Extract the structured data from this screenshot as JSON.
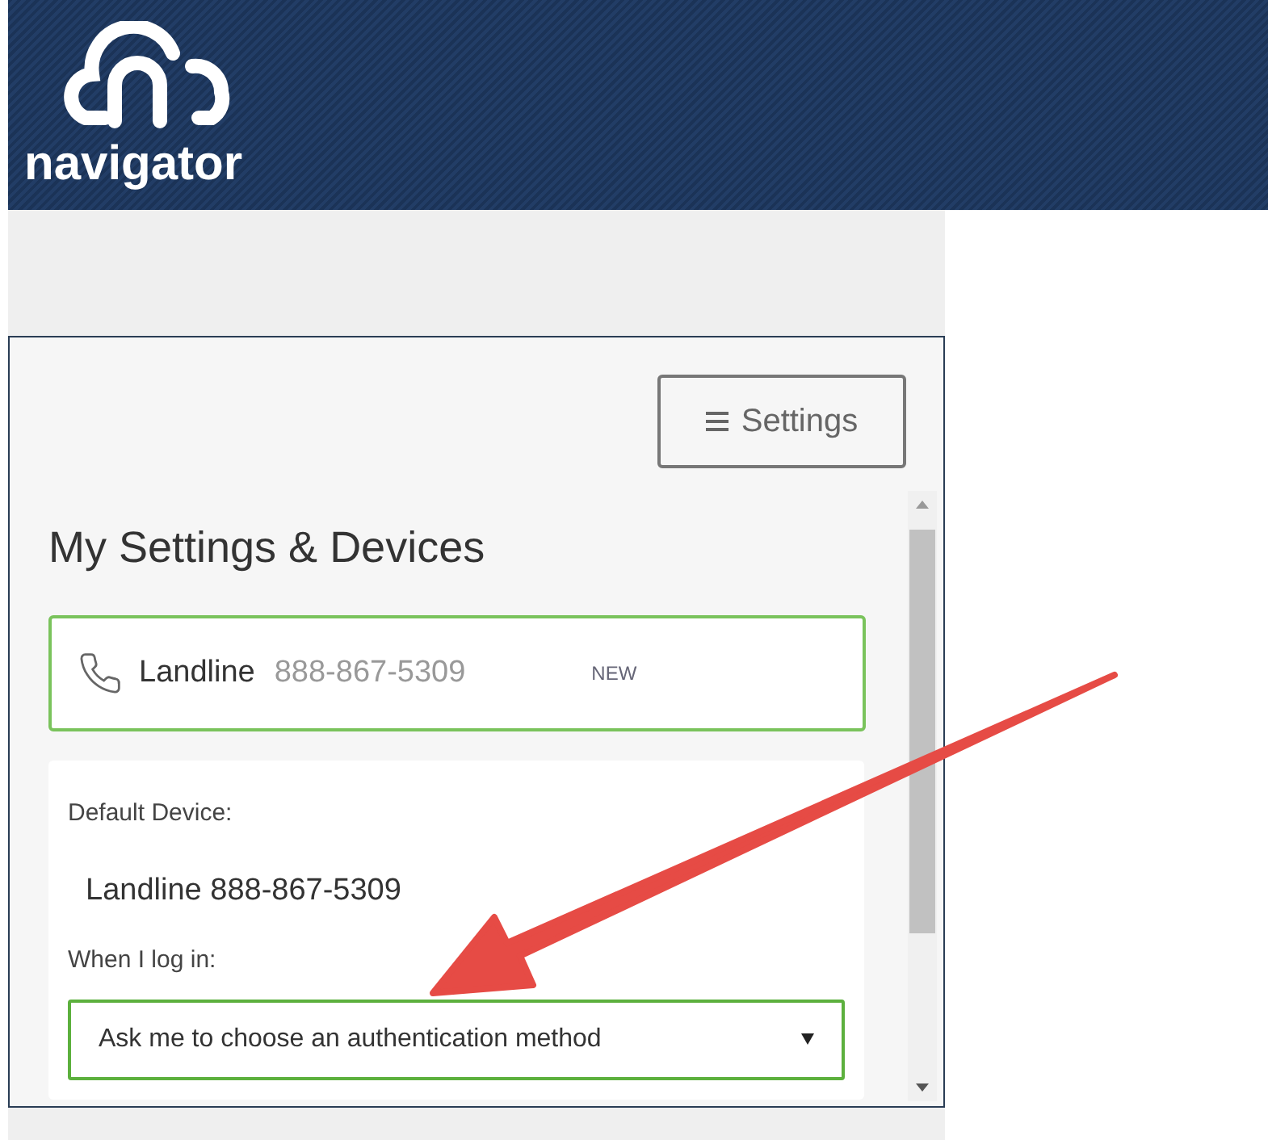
{
  "header": {
    "logo_text": "navigator"
  },
  "settings_button": {
    "label": "Settings"
  },
  "heading": "My Settings & Devices",
  "device": {
    "name": "Landline",
    "number": "888-867-5309",
    "badge": "NEW",
    "selected": true
  },
  "default_device": {
    "label": "Default Device:",
    "value": "Landline 888-867-5309"
  },
  "login": {
    "label": "When I log in:",
    "value": "Ask me to choose an authentication method"
  }
}
